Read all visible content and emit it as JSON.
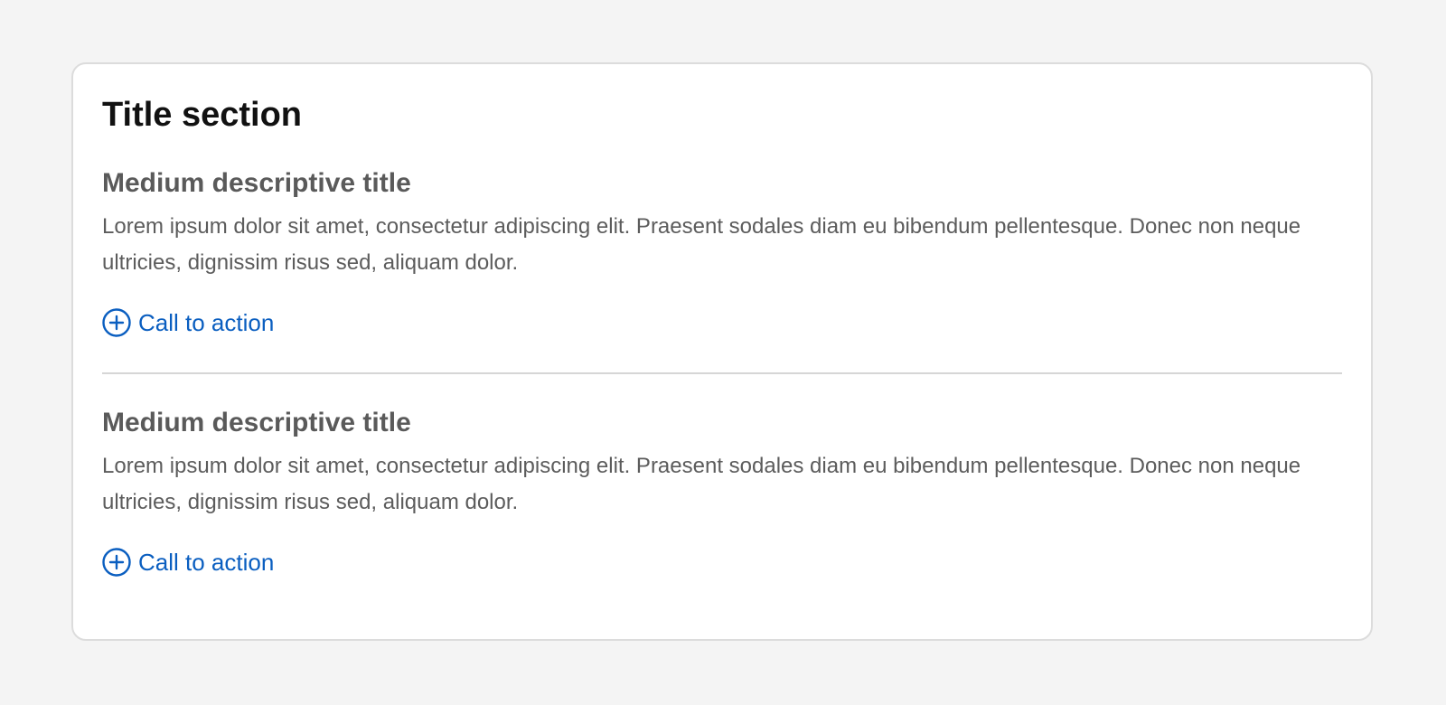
{
  "card": {
    "title": "Title section",
    "sections": [
      {
        "title": "Medium descriptive title",
        "body": "Lorem ipsum dolor sit amet, consectetur adipiscing elit. Praesent sodales diam eu bibendum pellentesque. Donec non neque ultricies, dignissim risus sed, aliquam dolor.",
        "cta_label": "Call to action",
        "cta_icon": "plus-circle-icon"
      },
      {
        "title": "Medium descriptive title",
        "body": "Lorem ipsum dolor sit amet, consectetur adipiscing elit. Praesent sodales diam eu bibendum pellentesque. Donec non neque ultricies, dignissim risus sed, aliquam dolor.",
        "cta_label": "Call to action",
        "cta_icon": "plus-circle-icon"
      }
    ]
  },
  "colors": {
    "background": "#f4f4f4",
    "card": "#ffffff",
    "border": "#dcdcdc",
    "title": "#111111",
    "text": "#5c5c5c",
    "link": "#0a5ec0"
  }
}
